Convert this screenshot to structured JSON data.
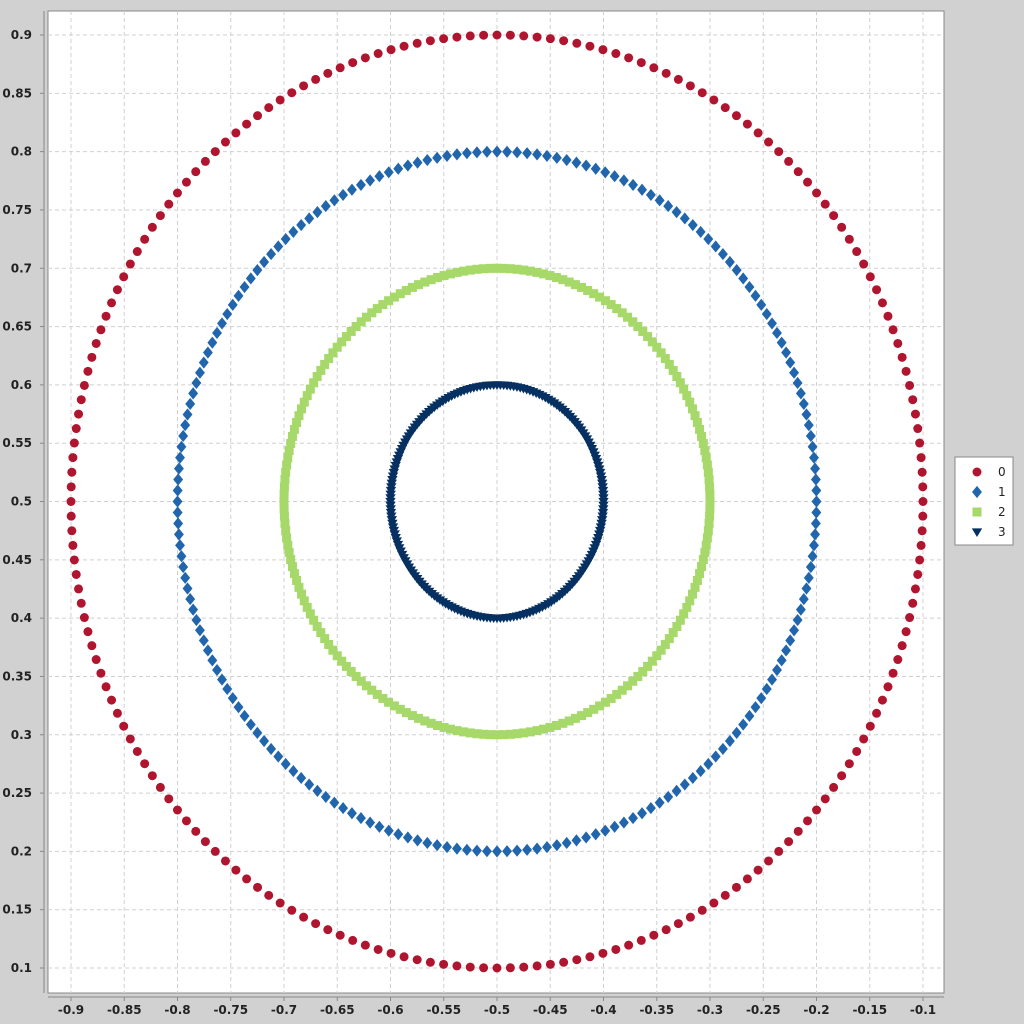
{
  "chart_data": {
    "type": "scatter",
    "title": "",
    "xlabel": "",
    "ylabel": "",
    "xlim": [
      -0.92,
      -0.08
    ],
    "ylim": [
      0.08,
      0.92
    ],
    "grid": true,
    "legend_position": "right",
    "x_ticks": [
      "-0.9",
      "-0.85",
      "-0.8",
      "-0.75",
      "-0.7",
      "-0.65",
      "-0.6",
      "-0.55",
      "-0.5",
      "-0.45",
      "-0.4",
      "-0.35",
      "-0.3",
      "-0.25",
      "-0.2",
      "-0.15",
      "-0.1"
    ],
    "y_ticks": [
      "0.1",
      "0.15",
      "0.2",
      "0.25",
      "0.3",
      "0.35",
      "0.4",
      "0.45",
      "0.5",
      "0.55",
      "0.6",
      "0.65",
      "0.7",
      "0.75",
      "0.8",
      "0.85",
      "0.9"
    ],
    "series": [
      {
        "name": "0",
        "marker": "circle",
        "color": "#b0152f",
        "center": [
          -0.5,
          0.5
        ],
        "radius": 0.4,
        "points": 200
      },
      {
        "name": "1",
        "marker": "diamond",
        "color": "#2166ac",
        "center": [
          -0.5,
          0.5
        ],
        "radius": 0.3,
        "points": 200
      },
      {
        "name": "2",
        "marker": "square",
        "color": "#a6d96a",
        "center": [
          -0.5,
          0.5
        ],
        "radius": 0.2,
        "points": 200
      },
      {
        "name": "3",
        "marker": "triangle-down",
        "color": "#053061",
        "center": [
          -0.5,
          0.5
        ],
        "radius": 0.1,
        "points": 200
      }
    ]
  },
  "colors": {
    "background": "#d1d1d1",
    "plot_background": "#ffffff",
    "grid": "#d0d0d0"
  }
}
